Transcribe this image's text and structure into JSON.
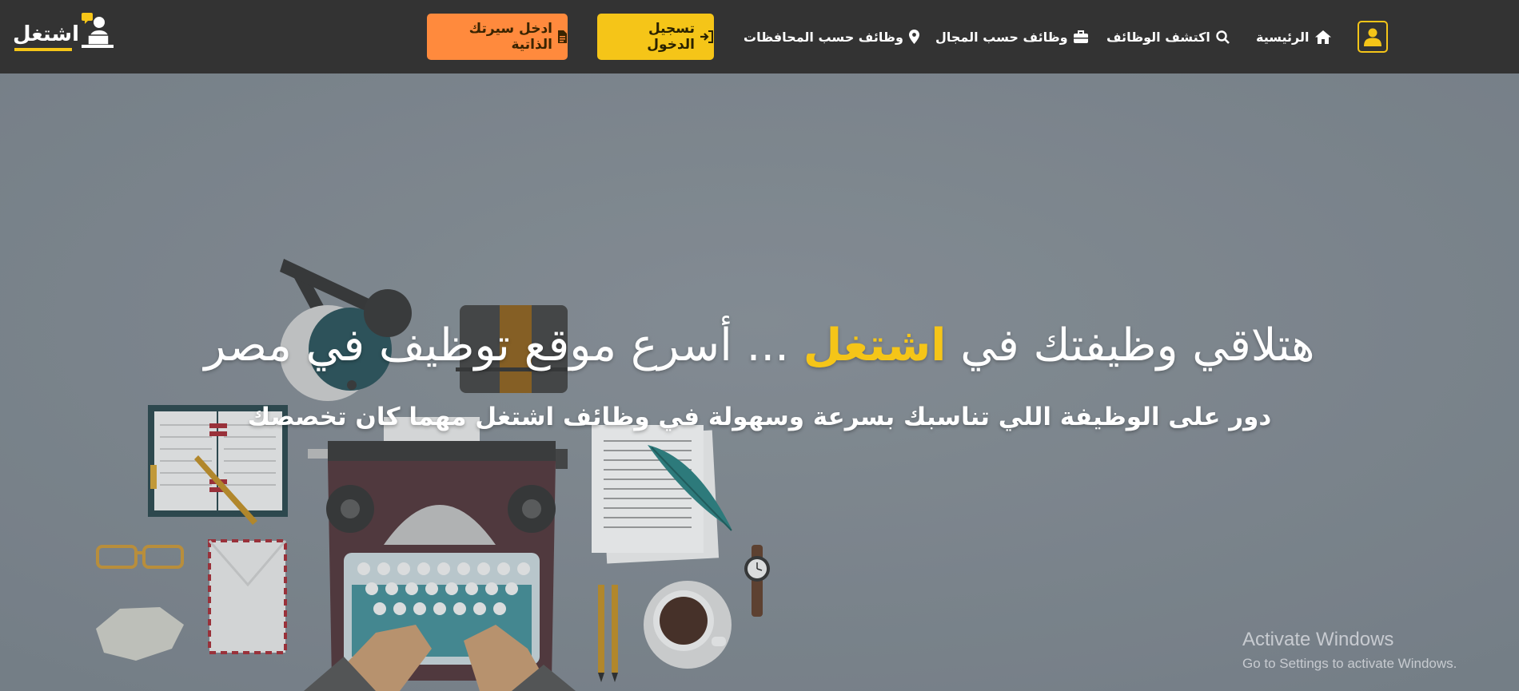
{
  "brand": {
    "logo_text": "اشتغل"
  },
  "nav": {
    "cv_button": "ادخل سيرتك الذاتية",
    "login_button": "تسجيل الدخول",
    "by_governorate": "وظائف حسب المحافظات",
    "by_field": "وظائف حسب المجال",
    "explore_jobs": "اكتشف الوظائف",
    "home": "الرئيسية"
  },
  "hero": {
    "title_part1": "هتلاقي وظيفتك في ",
    "title_brand": "اشتغل",
    "title_part2": " ... أسرع موقع توظيف في مصر",
    "subtitle": "دور على الوظيفة اللي تناسبك بسرعة وسهولة في وظائف اشتغل مهما كان تخصصك"
  },
  "watermark": {
    "title": "Activate Windows",
    "subtitle": "Go to Settings to activate Windows."
  },
  "icons": {
    "cv": "file-icon",
    "login": "sign-in-icon",
    "governorate": "map-marker-icon",
    "field": "briefcase-icon",
    "explore": "search-icon",
    "home": "home-icon",
    "user": "user-icon"
  },
  "colors": {
    "navbar_bg": "#333333",
    "accent_yellow": "#f5c518",
    "accent_orange": "#ff8a3d",
    "hero_bg": "#7d868e"
  }
}
